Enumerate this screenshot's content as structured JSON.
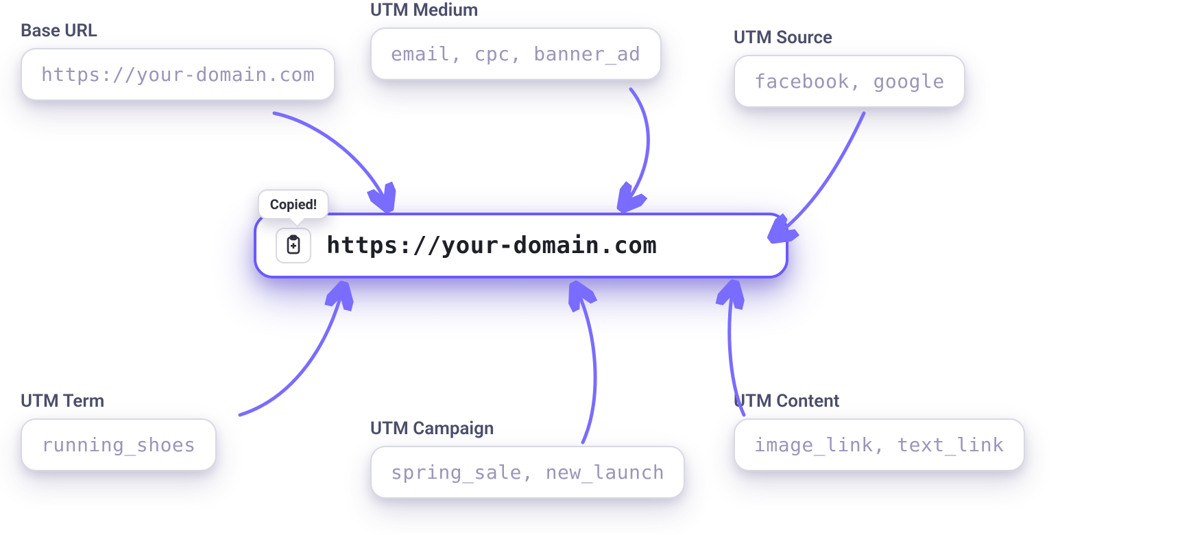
{
  "fields": {
    "base_url": {
      "label": "Base URL",
      "placeholder": "https://your-domain.com"
    },
    "utm_medium": {
      "label": "UTM Medium",
      "placeholder": "email, cpc, banner_ad"
    },
    "utm_source": {
      "label": "UTM Source",
      "placeholder": "facebook, google"
    },
    "utm_term": {
      "label": "UTM Term",
      "placeholder": "running_shoes"
    },
    "utm_campaign": {
      "label": "UTM Campaign",
      "placeholder": "spring_sale, new_launch"
    },
    "utm_content": {
      "label": "UTM Content",
      "placeholder": "image_link, text_link"
    }
  },
  "result": {
    "url": "https://your-domain.com",
    "tooltip": "Copied!"
  },
  "colors": {
    "accent": "#6a59ff",
    "arrow": "#7a6cff",
    "label": "#4a4e69",
    "placeholder": "#9a96b8"
  }
}
